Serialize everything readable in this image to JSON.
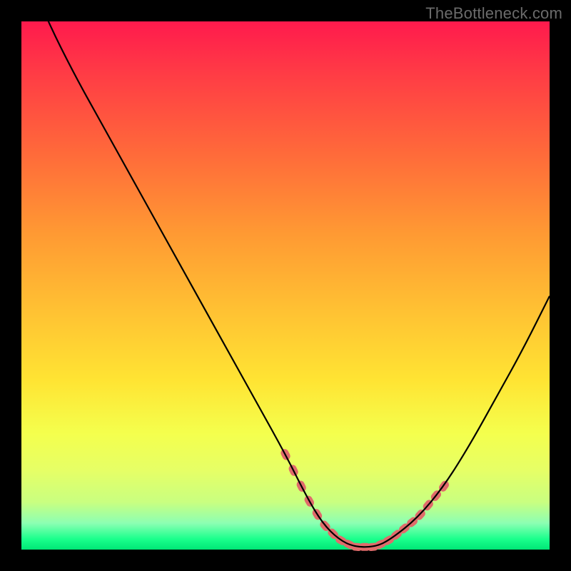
{
  "watermark": "TheBottleneck.com",
  "chart_data": {
    "type": "line",
    "title": "",
    "xlabel": "",
    "ylabel": "",
    "xlim": [
      0,
      100
    ],
    "ylim": [
      0,
      100
    ],
    "series": [
      {
        "name": "bottleneck-curve",
        "x": [
          0,
          5,
          10,
          15,
          20,
          25,
          30,
          35,
          40,
          45,
          50,
          54,
          57,
          60,
          63,
          67,
          70,
          75,
          80,
          85,
          90,
          95,
          100
        ],
        "values": [
          112,
          100,
          90,
          81,
          72,
          63,
          54,
          45,
          36,
          27,
          18,
          10,
          5,
          2,
          0.5,
          0.5,
          2,
          6,
          12,
          20,
          29,
          38,
          48
        ]
      }
    ],
    "highlight_segments": [
      {
        "side": "left",
        "x_start": 50,
        "x_end": 60
      },
      {
        "side": "right",
        "x_start": 65,
        "x_end": 80
      }
    ],
    "dash_points_left": [
      50,
      51.5,
      53,
      54.5,
      56,
      57.5,
      59,
      60.5,
      62,
      63.5,
      65,
      66.5
    ],
    "dash_points_right": [
      68,
      69.5,
      71,
      72.5,
      74,
      75.5,
      77,
      78.5,
      80
    ]
  },
  "colors": {
    "curve": "#000000",
    "dash": "#e06b6b",
    "gradient_top": "#ff1a4d",
    "gradient_mid": "#ffe433",
    "gradient_bottom": "#00e676"
  }
}
